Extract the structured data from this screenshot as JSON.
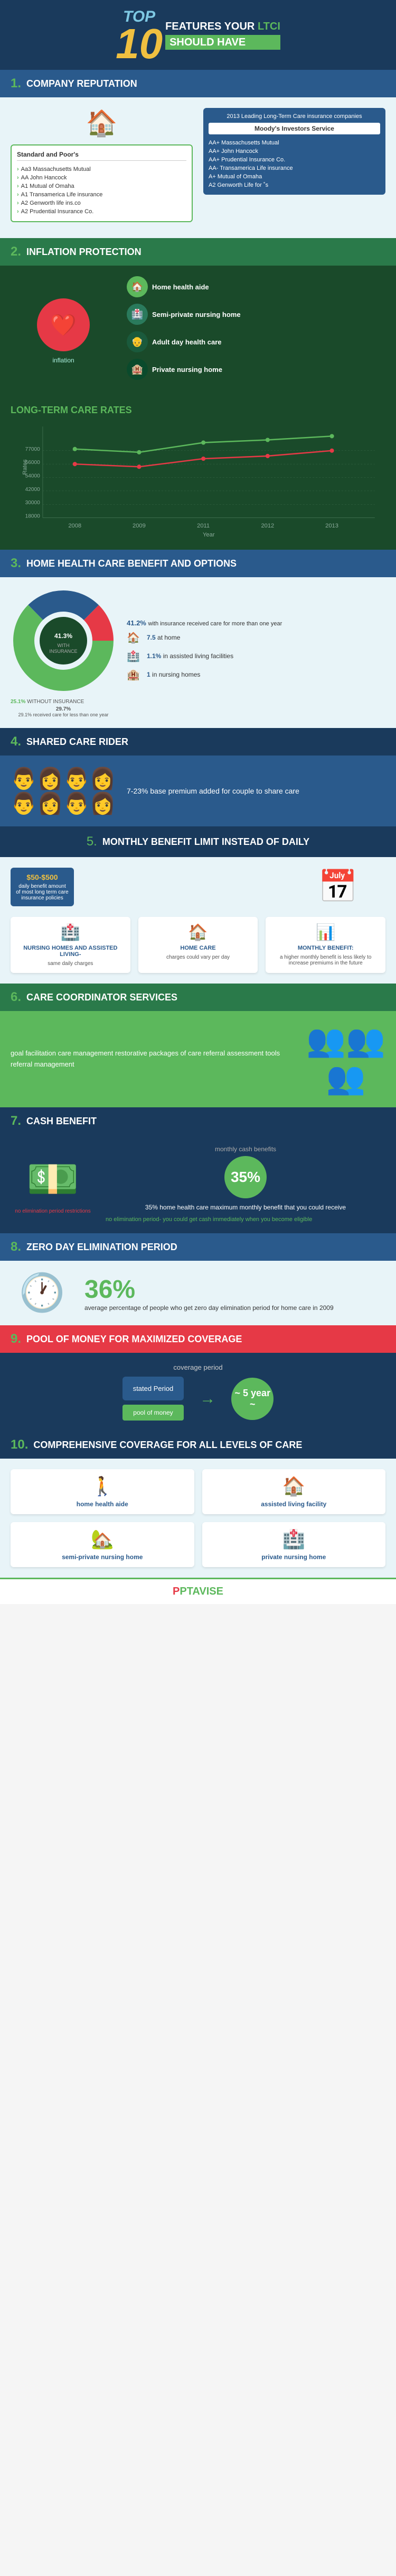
{
  "header": {
    "top_word": "TOP",
    "number": "10",
    "features": "FEATURES YOUR LTCI",
    "ltci": "LTCI",
    "should_have": "SHOULD HAVE"
  },
  "sections": {
    "s1": {
      "num": "1.",
      "title": "COMPANY REPUTATION",
      "sp_title": "Standard and Poor's",
      "sp_items": [
        "Aa3 Massachusetts Mutual",
        "AA John Hancock",
        "A1 Mutual of Omaha",
        "A1 Transamerica Life insurance",
        "A2 Genworth life ins.co",
        "A2 Prudential Insurance Co."
      ],
      "moody_year": "2013 Leading Long-Term Care insurance companies",
      "moody_label": "Moody's Investors Service",
      "moody_items": [
        "AA+ Massachusetts Mutual",
        "AA+ John Hancock",
        "AA+ Prudential Insurance Co.",
        "AA- Transamerica Life insurance",
        "A+ Mutual of Omaha",
        "A2 Genworth Life for ˚s"
      ]
    },
    "s2": {
      "num": "2.",
      "title": "INFLATION PROTECTION",
      "care_items": [
        {
          "icon": "🏠",
          "label": "Home health aide",
          "color": "#5cb85c"
        },
        {
          "icon": "🏥",
          "label": "Semi-private nursing home",
          "color": "#2a7a5c"
        },
        {
          "icon": "👴",
          "label": "Adult day health care",
          "color": "#1a5a3c"
        },
        {
          "icon": "🏨",
          "label": "Private nursing home",
          "color": "#0a4a2c"
        }
      ]
    },
    "rates": {
      "title": "LONG-TERM CARE RATES",
      "years": [
        "2008",
        "2009",
        "2011",
        "2012",
        "2013"
      ],
      "values": [
        77000,
        73000,
        84000,
        87000,
        90000
      ],
      "y_labels": [
        "18000",
        "30000",
        "42000",
        "54000",
        "66000",
        "77000"
      ],
      "y_axis_label": "Rates",
      "x_axis_label": "Year"
    },
    "s3": {
      "num": "3.",
      "title": "HOME HEALTH CARE BENEFIT AND OPTIONS",
      "no_insurance_pct": "25.1% WITHOUT INSURANCE",
      "with_insurance_pct": "41.2%",
      "with_insurance_text": "with insurance received care for more than one year",
      "under_one_year": "29.7%",
      "under_one_label": "29.1% received care for less than one year",
      "stat1_pct": "7.5",
      "stat1_label": "at home",
      "stat2_pct": "1.1%",
      "stat2_label": "in assisted living facilities",
      "stat3_pct": "1",
      "stat3_label": "in nursing homes"
    },
    "s4": {
      "num": "4.",
      "title": "SHARED CARE RIDER",
      "text": "7-23% base premium added for couple to share care"
    },
    "s5": {
      "num": "5.",
      "title": "MONTHLY BENEFIT LIMIT INSTEAD OF DAILY",
      "range": "$50-$500",
      "range_desc": "daily benefit amount of most long term care insurance policies",
      "card1_title": "NURSING HOMES AND ASSISTED LIVING-",
      "card1_text": "same daily charges",
      "card2_title": "HOME CARE",
      "card2_text": "charges could vary per day",
      "card3_title": "MONTHLY BENEFIT:",
      "card3_text": "a higher monthly benefit is less likely to increase premiums in the future"
    },
    "s6": {
      "num": "6.",
      "title": "CARE COORDINATOR SERVICES",
      "text": "goal facilitation care management restorative packages of care referral assessment tools referral management"
    },
    "s7": {
      "num": "7.",
      "title": "CASH BENEFIT",
      "monthly_label": "monthly cash benefits",
      "pct": "35%",
      "desc": "35% home health care maximum monthly benefit that you could receive",
      "no_elim": "no elimination period- you could get cash immediately when you become eligible"
    },
    "s8": {
      "num": "8.",
      "title": "ZERO DAY ELIMINATION PERIOD",
      "pct": "36%",
      "desc": "average percentage of people who get zero day elimination period for home care in 2009"
    },
    "s9": {
      "num": "9.",
      "title": "POOL OF MONEY FOR MAXIMIZED COVERAGE",
      "coverage_period": "coverage period",
      "stated_period": "stated Period",
      "five_year": "~ 5 year ~",
      "pool_money": "pool of money"
    },
    "s10": {
      "num": "10.",
      "title": "COMPREHENSIVE COVERAGE FOR ALL LEVELS OF CARE",
      "cards": [
        {
          "icon": "🚶",
          "label": "home health aide"
        },
        {
          "icon": "🏠",
          "label": "assisted living facility"
        },
        {
          "icon": "🏡",
          "label": "semi-private nursing home"
        },
        {
          "icon": "🏥",
          "label": "private nursing home"
        }
      ]
    }
  },
  "footer": {
    "logo_text": "PTAVISE"
  }
}
